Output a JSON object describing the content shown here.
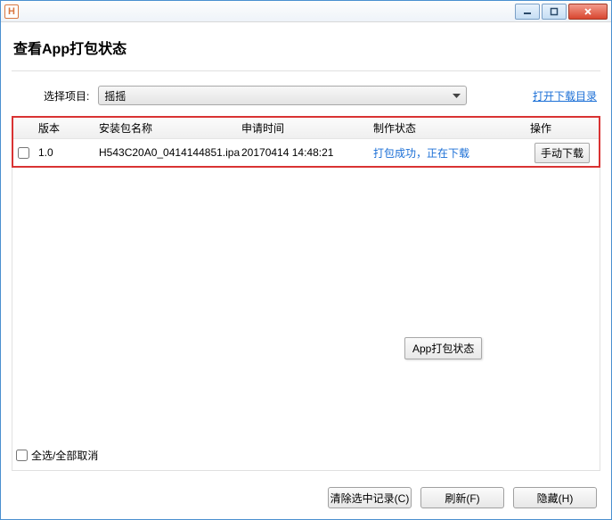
{
  "titlebar": {
    "icon_letter": "H"
  },
  "page": {
    "title": "查看App打包状态"
  },
  "toolbar": {
    "select_label": "选择项目:",
    "select_value": "摇摇",
    "open_dir_link": "打开下载目录"
  },
  "table": {
    "headers": {
      "version": "版本",
      "package": "安装包名称",
      "time": "申请时间",
      "status": "制作状态",
      "action": "操作"
    },
    "rows": [
      {
        "version": "1.0",
        "package": "H543C20A0_0414144851.ipa",
        "time": "20170414 14:48:21",
        "status": "打包成功，正在下载",
        "action_label": "手动下载"
      }
    ]
  },
  "tooltip": {
    "text": "App打包状态"
  },
  "footer": {
    "select_all": "全选/全部取消"
  },
  "buttons": {
    "clear": "清除选中记录(C)",
    "refresh": "刷新(F)",
    "hide": "隐藏(H)"
  }
}
